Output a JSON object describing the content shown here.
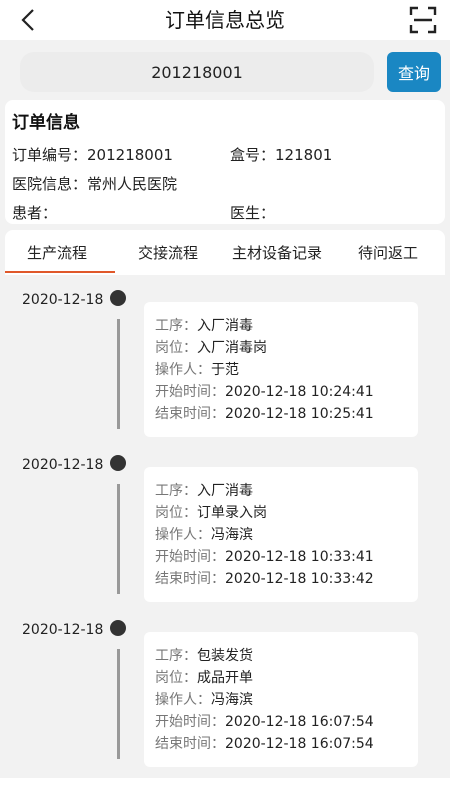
{
  "header": {
    "title": "订单信息总览",
    "back_icon": "back-arrow-icon",
    "scan_icon": "scan-icon"
  },
  "search": {
    "value": "201218001",
    "placeholder": "",
    "button_label": "查询",
    "button_color": "#1a87c3"
  },
  "order_info": {
    "title": "订单信息",
    "order_no_label": "订单编号：",
    "order_no": "201218001",
    "box_no_label": "盒号：",
    "box_no": "121801",
    "hospital_label": "医院信息：",
    "hospital": "常州人民医院",
    "patient_label": "患者：",
    "patient": "",
    "doctor_label": "医生：",
    "doctor": ""
  },
  "tabs": [
    {
      "label": "生产流程",
      "active": true
    },
    {
      "label": "交接流程",
      "active": false
    },
    {
      "label": "主材设备记录",
      "active": false
    },
    {
      "label": "待问返工",
      "active": false
    }
  ],
  "active_tab_color": "#e0582a",
  "timeline": {
    "labels": {
      "process": "工序：",
      "post": "岗位：",
      "operator": "操作人：",
      "start": "开始时间：",
      "end": "结束时间："
    },
    "entries": [
      {
        "date": "2020-12-18",
        "process": "入厂消毒",
        "post": "入厂消毒岗",
        "operator": "于范",
        "start": "2020-12-18 10:24:41",
        "end": "2020-12-18 10:25:41"
      },
      {
        "date": "2020-12-18",
        "process": "入厂消毒",
        "post": "订单录入岗",
        "operator": "冯海滨",
        "start": "2020-12-18 10:33:41",
        "end": "2020-12-18 10:33:42"
      },
      {
        "date": "2020-12-18",
        "process": "包装发货",
        "post": "成品开单",
        "operator": "冯海滨",
        "start": "2020-12-18 16:07:54",
        "end": "2020-12-18 16:07:54"
      }
    ]
  }
}
